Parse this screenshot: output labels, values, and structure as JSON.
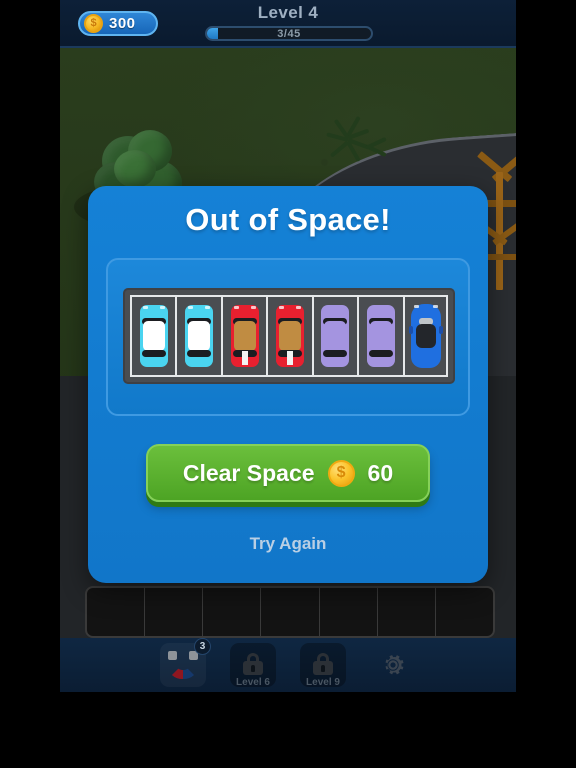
{
  "hud": {
    "coin_icon": "coin-icon",
    "coin_symbol": "$",
    "coin_amount": "300",
    "level_title": "Level 4",
    "progress_text": "3/45",
    "progress_current": 3,
    "progress_total": 45
  },
  "modal": {
    "title": "Out of Space!",
    "cars": [
      {
        "slot": 1,
        "body": "#4ad4f0",
        "roof": "#ffffff",
        "type": "sedan",
        "stripe": false
      },
      {
        "slot": 2,
        "body": "#4ad4f0",
        "roof": "#ffffff",
        "type": "sedan",
        "stripe": false
      },
      {
        "slot": 3,
        "body": "#e8202f",
        "roof": "#c08c42",
        "type": "sedan",
        "stripe": true
      },
      {
        "slot": 4,
        "body": "#e8202f",
        "roof": "#c08c42",
        "type": "sedan",
        "stripe": true
      },
      {
        "slot": 5,
        "body": "#a494e0",
        "roof": "#a494e0",
        "type": "sedan",
        "stripe": false
      },
      {
        "slot": 6,
        "body": "#a494e0",
        "roof": "#a494e0",
        "type": "sedan",
        "stripe": false
      },
      {
        "slot": 7,
        "body": "#1f6fe0",
        "roof": "#23262b",
        "type": "sport",
        "stripe": false
      }
    ],
    "cta_label": "Clear Space",
    "cta_coin_icon": "coin-icon",
    "cta_coin_symbol": "$",
    "cta_cost": "60",
    "secondary_label": "Try Again"
  },
  "bottom_bar": {
    "tools": [
      {
        "name": "magnet",
        "icon": "magnet-icon",
        "badge": "3",
        "locked": false,
        "label": ""
      },
      {
        "name": "locked-slot-1",
        "icon": "lock-icon",
        "badge": "",
        "locked": true,
        "label": "Level 6"
      },
      {
        "name": "locked-slot-2",
        "icon": "lock-icon",
        "badge": "",
        "locked": true,
        "label": "Level 9"
      },
      {
        "name": "settings",
        "icon": "gear-icon",
        "badge": "",
        "locked": false,
        "label": ""
      }
    ]
  },
  "board": {
    "empty_slot_count": 7
  },
  "colors": {
    "modal_blue": "#1581d6",
    "cta_green": "#5cb32f",
    "hud_navy": "#0d2038",
    "grass": "#243518",
    "coin_gold": "#fbc32b"
  }
}
